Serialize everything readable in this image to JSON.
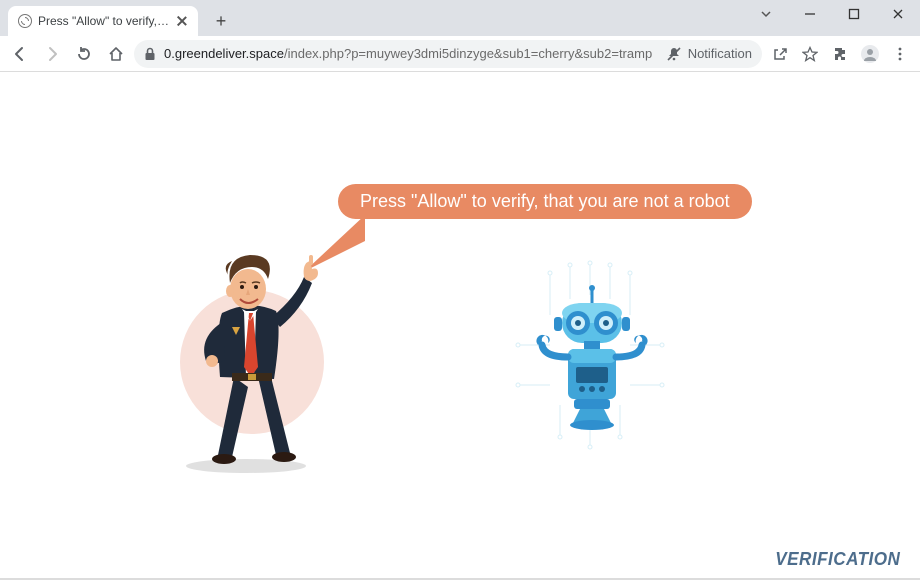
{
  "tab": {
    "title": "Press \"Allow\" to verify, that you a"
  },
  "address": {
    "domain": "0.greendeliver.space",
    "path": "/index.php?p=muywey3dmi5dinzyge&sub1=cherry&sub2=tramp",
    "notification_label": "Notification"
  },
  "bubble": {
    "text": "Press \"Allow\" to verify, that you are not a robot"
  },
  "footer": {
    "verification": "VERIFICATION"
  },
  "colors": {
    "bubble": "#e88a63",
    "pink_circle": "#f8e0d9",
    "robot_primary": "#2f8fce",
    "robot_secondary": "#5bc0e8",
    "verification_text": "#4d6d8c"
  }
}
